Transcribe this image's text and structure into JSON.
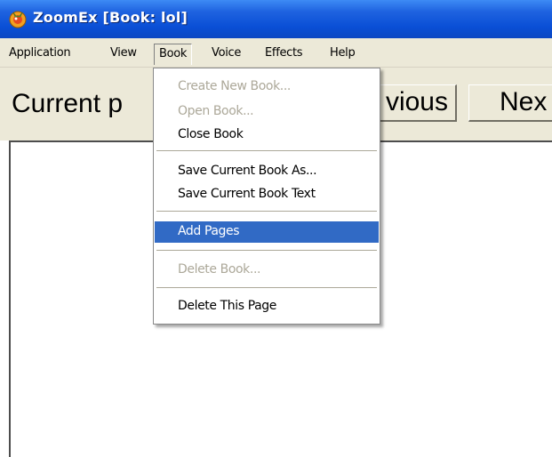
{
  "window": {
    "title": "ZoomEx [Book: lol]",
    "icon": "zoomex-app-icon"
  },
  "menubar": {
    "items": [
      {
        "label": "Application"
      },
      {
        "label": "View"
      },
      {
        "label": "Book",
        "active": true
      },
      {
        "label": "Voice"
      },
      {
        "label": "Effects"
      },
      {
        "label": "Help"
      }
    ]
  },
  "toolbar": {
    "current_page_label": "Current p",
    "previous_label": "vious",
    "next_label": "Nex"
  },
  "book_menu": {
    "items": [
      {
        "label": "Create New Book...",
        "enabled": false
      },
      {
        "label": "Open Book...",
        "enabled": false
      },
      {
        "label": "Close Book",
        "enabled": true
      },
      {
        "label": "Save Current Book As...",
        "enabled": true
      },
      {
        "label": "Save Current Book Text",
        "enabled": true
      },
      {
        "label": "Add Pages",
        "enabled": true,
        "highlighted": true
      },
      {
        "label": "Delete Book...",
        "enabled": false
      },
      {
        "label": "Delete This Page",
        "enabled": true
      }
    ]
  },
  "colors": {
    "titlebar": "#0a4fd6",
    "menu_bg": "#ece9d8",
    "highlight": "#316ac5",
    "disabled_text": "#aca899"
  }
}
